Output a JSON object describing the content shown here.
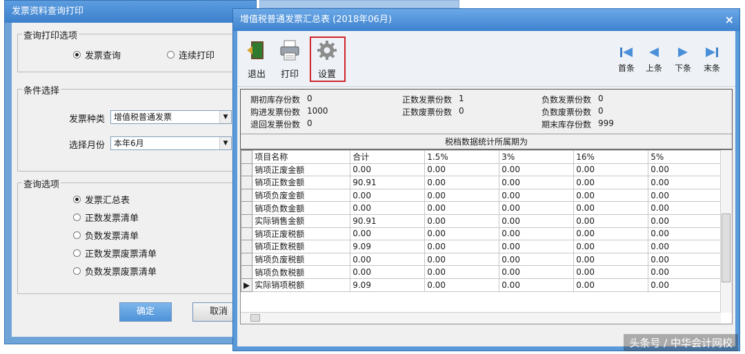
{
  "bg_dialog": {
    "title": "发票资料查询打印",
    "print_options": {
      "legend": "查询打印选项",
      "opt1": "发票查询",
      "opt2": "连续打印"
    },
    "conditions": {
      "legend": "条件选择",
      "type_label": "发票种类",
      "type_value": "增值税普通发票",
      "month_label": "选择月份",
      "month_value": "本年6月"
    },
    "query_options": {
      "legend": "查询选项",
      "items": [
        "发票汇总表",
        "正数发票清单",
        "负数发票清单",
        "正数发票废票清单",
        "负数发票废票清单"
      ]
    },
    "ok_label": "确定",
    "cancel_label": "取消"
  },
  "window": {
    "title": "增值税普通发票汇总表 (2018年06月)",
    "close": "×",
    "toolbar": {
      "exit": "退出",
      "print": "打印",
      "settings": "设置",
      "first": "首条",
      "prev": "上条",
      "next": "下条",
      "last": "末条"
    },
    "summary": {
      "opening_stock_label": "期初库存份数",
      "opening_stock": "0",
      "purchased_label": "购进发票份数",
      "purchased": "1000",
      "returned_label": "退回发票份数",
      "returned": "0",
      "positive_label": "正数发票份数",
      "positive": "1",
      "positive_void_label": "正数废票份数",
      "positive_void": "0",
      "negative_label": "负数发票份数",
      "negative": "0",
      "negative_void_label": "负数废票份数",
      "negative_void": "0",
      "closing_stock_label": "期末库存份数",
      "closing_stock": "999",
      "period_label": "税档数据统计所属期为"
    },
    "grid": {
      "headers": [
        "项目名称",
        "合计",
        "1.5%",
        "3%",
        "16%",
        "5%"
      ],
      "rows": [
        [
          "销项正废金额",
          "0.00",
          "0.00",
          "0.00",
          "0.00",
          "0.00"
        ],
        [
          "销项正数金额",
          "90.91",
          "0.00",
          "0.00",
          "0.00",
          "0.00"
        ],
        [
          "销项负废金额",
          "0.00",
          "0.00",
          "0.00",
          "0.00",
          "0.00"
        ],
        [
          "销项负数金额",
          "0.00",
          "0.00",
          "0.00",
          "0.00",
          "0.00"
        ],
        [
          "实际销售金额",
          "90.91",
          "0.00",
          "0.00",
          "0.00",
          "0.00"
        ],
        [
          "销项正废税额",
          "0.00",
          "0.00",
          "0.00",
          "0.00",
          "0.00"
        ],
        [
          "销项正数税额",
          "9.09",
          "0.00",
          "0.00",
          "0.00",
          "0.00"
        ],
        [
          "销项负废税额",
          "0.00",
          "0.00",
          "0.00",
          "0.00",
          "0.00"
        ],
        [
          "销项负数税额",
          "0.00",
          "0.00",
          "0.00",
          "0.00",
          "0.00"
        ],
        [
          "实际销项税额",
          "9.09",
          "0.00",
          "0.00",
          "0.00",
          "0.00"
        ]
      ],
      "current_row_marker": "▶"
    }
  },
  "watermark": "头条号 / 中华会计网校",
  "colors": {
    "title_blue": "#3e82cf",
    "highlight_red": "#d0242a"
  }
}
